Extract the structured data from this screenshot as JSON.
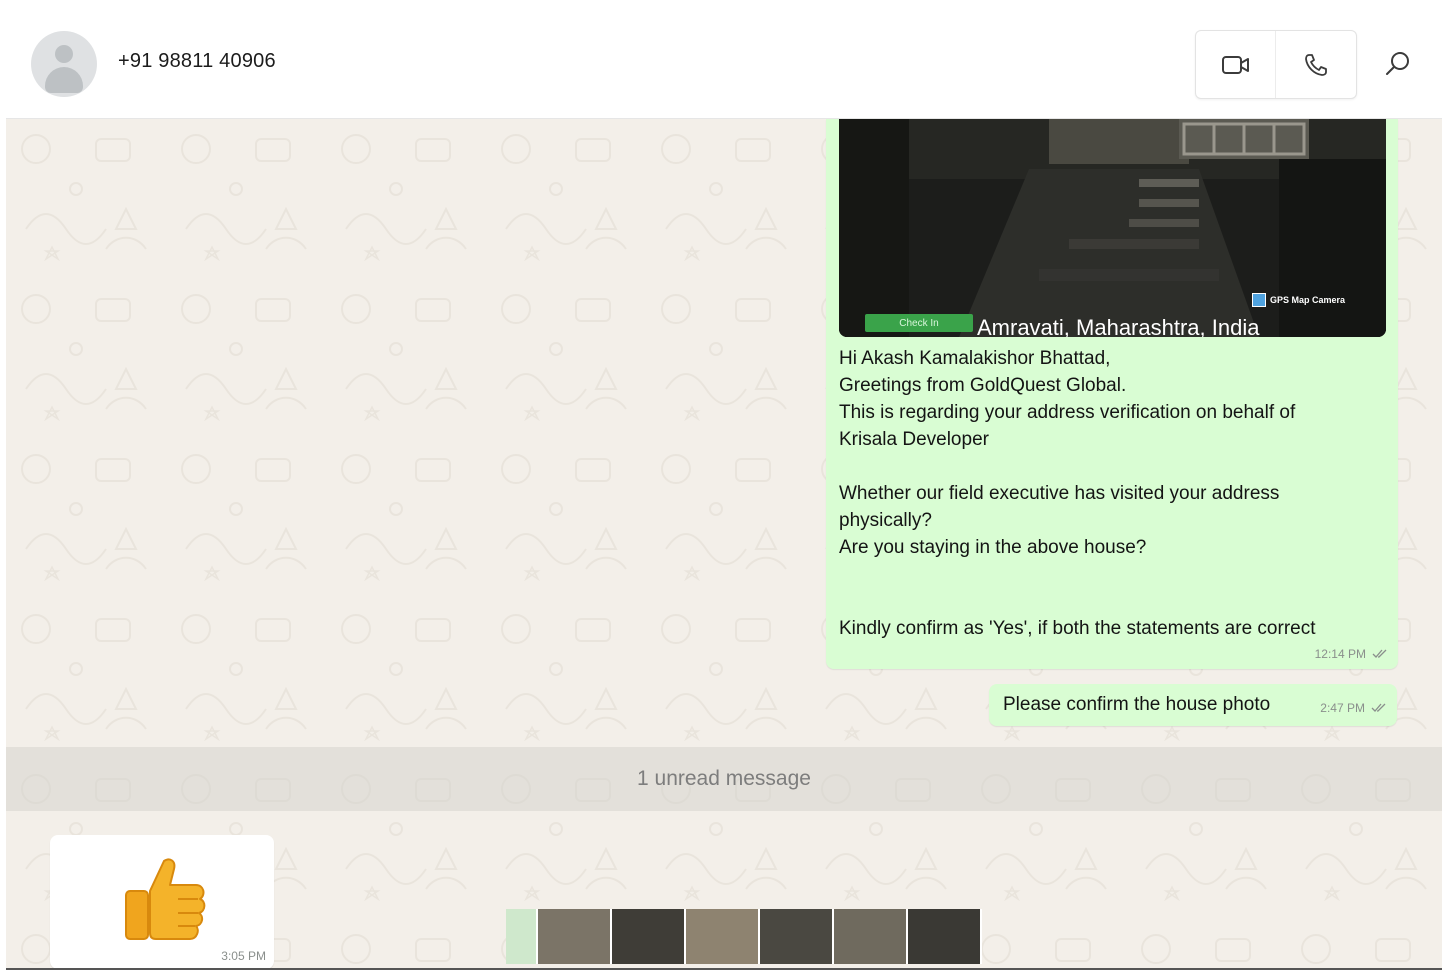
{
  "header": {
    "contact_name": "+91 98811 40906",
    "avatar_icon": "default-user-avatar-icon",
    "video_call_icon": "video-camera-icon",
    "voice_call_icon": "phone-icon",
    "search_icon": "search-icon"
  },
  "messages": {
    "outgoing_photo": {
      "photo_caption": "Amravati, Maharashtra, India",
      "checkin_label": "Check In",
      "gps_label": "GPS Map Camera",
      "lines_block1": [
        "Hi Akash Kamalakishor Bhattad,",
        "Greetings from GoldQuest Global.",
        "This is regarding your address verification on behalf of",
        "Krisala Developer"
      ],
      "lines_block2": [
        "Whether our field executive has visited your address",
        "physically?",
        "Are you staying in the above house?"
      ],
      "lines_block3": [
        "Kindly confirm as 'Yes', if both the statements are correct"
      ],
      "time": "12:14 PM",
      "status_icon": "double-check-icon"
    },
    "outgoing_text": {
      "text": "Please confirm the house photo",
      "time": "2:47 PM",
      "status_icon": "double-check-icon"
    },
    "unread_divider": "1 unread message",
    "incoming_emoji": {
      "emoji_icon": "thumbs-up-emoji-icon",
      "time": "3:05 PM"
    }
  },
  "colors": {
    "outgoing_bubble": "#d9fdd3",
    "incoming_bubble": "#ffffff",
    "chat_background": "#f3efe9",
    "header_background": "#ffffff"
  }
}
